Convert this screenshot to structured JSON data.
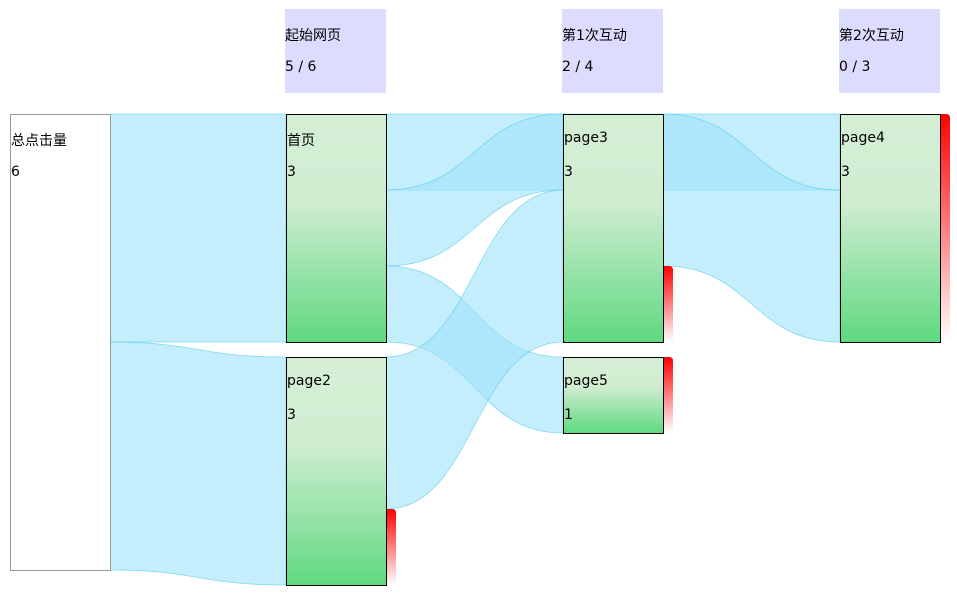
{
  "colors": {
    "stage_header_bg": "#dcdcff",
    "link_fill": "#9fe3fb",
    "link_stroke": "#57cdee",
    "node_gradient_top": "#d4eed4",
    "node_gradient_bottom": "#5fd97f",
    "dropoff": "#ff0000",
    "total_node_fill": "#ffffff"
  },
  "stages": [
    {
      "name": "起始网页",
      "count": "5 / 6"
    },
    {
      "name": "第1次互动",
      "count": "2 / 4"
    },
    {
      "name": "第2次互动",
      "count": "0 / 3"
    }
  ],
  "chart_data": {
    "type": "sankey",
    "nodes": [
      {
        "id": "total",
        "label": "总点击量",
        "value": "6",
        "column": 0
      },
      {
        "id": "home",
        "label": "首页",
        "value": "3",
        "column": 1
      },
      {
        "id": "page2",
        "label": "page2",
        "value": "3",
        "column": 1
      },
      {
        "id": "page3",
        "label": "page3",
        "value": "3",
        "column": 2
      },
      {
        "id": "page5",
        "label": "page5",
        "value": "1",
        "column": 2
      },
      {
        "id": "page4",
        "label": "page4",
        "value": "3",
        "column": 3
      }
    ],
    "links": [
      {
        "source": "total",
        "target": "home",
        "value": 3
      },
      {
        "source": "total",
        "target": "page2",
        "value": 3
      },
      {
        "source": "home",
        "target": "page4",
        "value": 1
      },
      {
        "source": "home",
        "target": "page3",
        "value": 1
      },
      {
        "source": "home",
        "target": "page5",
        "value": 1
      },
      {
        "source": "page2",
        "target": "page3",
        "value": 2
      },
      {
        "source": "page3",
        "target": "page4",
        "value": 2
      }
    ],
    "dropoffs": [
      {
        "node": "page2",
        "value": 1
      },
      {
        "node": "page3",
        "value": 1
      },
      {
        "node": "page5",
        "value": 1
      },
      {
        "node": "page4",
        "value": 3
      }
    ]
  }
}
